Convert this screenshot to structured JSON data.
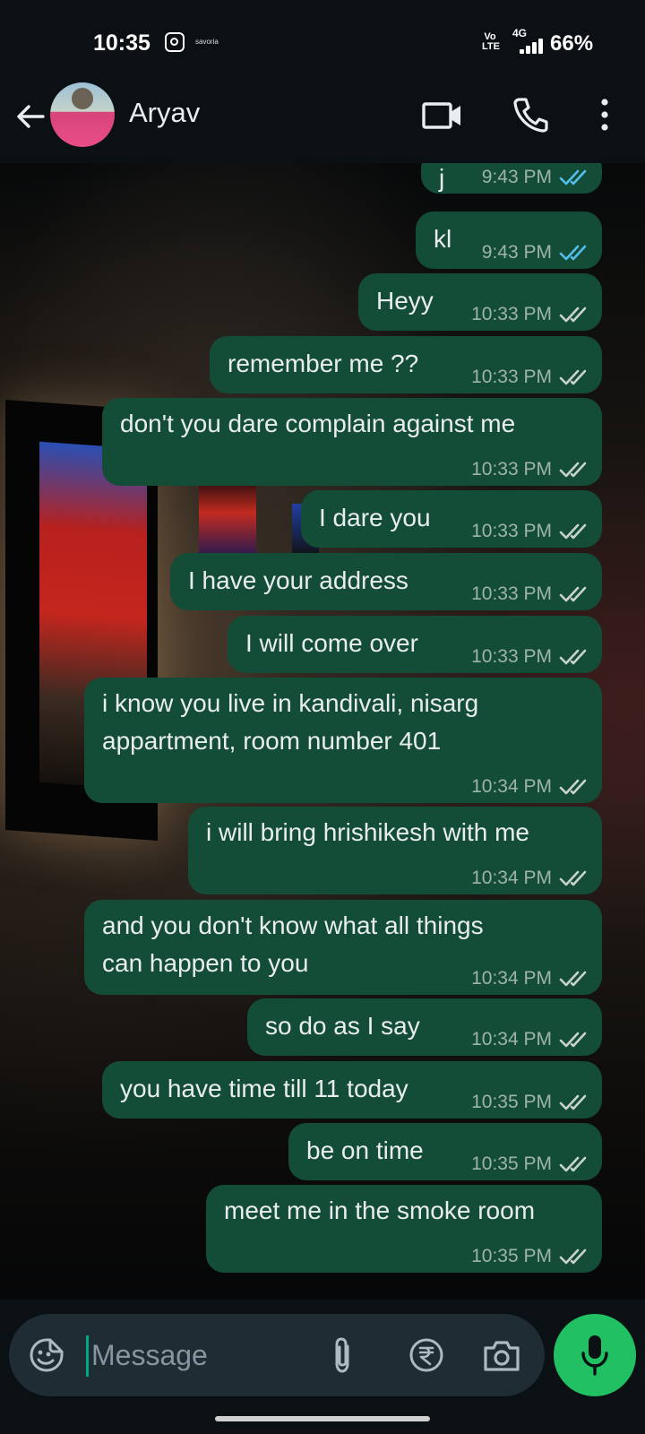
{
  "status_bar": {
    "time": "10:35",
    "notif_app": "savoria",
    "network_volte": "Vo\nLTE",
    "network_type": "4G",
    "battery": "66%"
  },
  "header": {
    "contact_name": "Aryav",
    "icons": [
      "back-arrow-icon",
      "video-call-icon",
      "voice-call-icon",
      "more-options-icon"
    ]
  },
  "messages": [
    {
      "text": "j",
      "time": "9:43 PM",
      "status": "read"
    },
    {
      "text": "kl",
      "time": "9:43 PM",
      "status": "read"
    },
    {
      "text": "Heyy",
      "time": "10:33 PM",
      "status": "delivered"
    },
    {
      "text": "remember me ??",
      "time": "10:33 PM",
      "status": "delivered"
    },
    {
      "text": "don't you dare complain against me",
      "time": "10:33 PM",
      "status": "delivered"
    },
    {
      "text": "I dare you",
      "time": "10:33 PM",
      "status": "delivered"
    },
    {
      "text": "I have your address",
      "time": "10:33 PM",
      "status": "delivered"
    },
    {
      "text": "I will come over",
      "time": "10:33 PM",
      "status": "delivered"
    },
    {
      "text": "i know you live in kandivali, nisarg\nappartment, room number 401",
      "time": "10:34 PM",
      "status": "delivered"
    },
    {
      "text": "i will bring hrishikesh with me",
      "time": "10:34 PM",
      "status": "delivered"
    },
    {
      "text": "and you don't know what all things\ncan happen to you",
      "time": "10:34 PM",
      "status": "delivered"
    },
    {
      "text": "so do as I say",
      "time": "10:34 PM",
      "status": "delivered"
    },
    {
      "text": "you have time till 11 today",
      "time": "10:35 PM",
      "status": "delivered"
    },
    {
      "text": "be on time",
      "time": "10:35 PM",
      "status": "delivered"
    },
    {
      "text": "meet me in the smoke room",
      "time": "10:35 PM",
      "status": "delivered"
    }
  ],
  "composer": {
    "placeholder": "Message",
    "icons": [
      "emoji-sticker-icon",
      "attach-icon",
      "rupee-payment-icon",
      "camera-icon",
      "mic-icon"
    ]
  },
  "colors": {
    "bubble": "#144d37",
    "read_tick": "#53bdeb",
    "delivered_tick": "#c9d3ce",
    "mic_button": "#21c063",
    "input_bar": "#1f2c33"
  }
}
